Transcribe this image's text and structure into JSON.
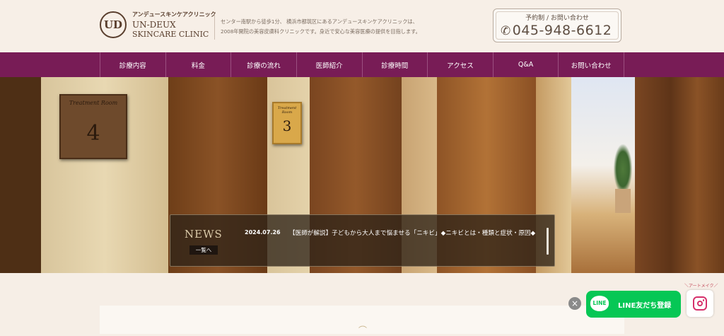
{
  "header": {
    "logo_mark": "UD",
    "logo_jp": "アンデュースキンケアクリニック",
    "logo_en_line1": "UN-DEUX",
    "logo_en_line2": "SKINCARE CLINIC",
    "description_line1": "センター南駅から徒歩1分、 横浜市都筑区にあるアンデュースキンケアクリニックは、",
    "description_line2": "2008年開院の美容皮膚科クリニックです。身近で安心な美容医療の提供を目指します。",
    "contact_label": "予約制 / お問い合わせ",
    "phone": "045-948-6612",
    "phone_icon": "phone-icon"
  },
  "nav": {
    "items": [
      {
        "label": "診療内容"
      },
      {
        "label": "料金"
      },
      {
        "label": "診療の流れ"
      },
      {
        "label": "医師紹介"
      },
      {
        "label": "診療時間"
      },
      {
        "label": "アクセス"
      },
      {
        "label": "Q&A"
      },
      {
        "label": "お問い合わせ"
      }
    ]
  },
  "hero": {
    "sign_left_title": "Treatment Room",
    "sign_left_number": "4",
    "sign_right_title": "Treatment Room",
    "sign_right_number": "3"
  },
  "news": {
    "title": "NEWS",
    "more_label": "一覧へ",
    "items": [
      {
        "date": "2024.07.26",
        "text": "【医師が解説】子どもから大人まで悩ませる「ニキビ」◆ニキビとは・種類と症状・原因◆"
      }
    ]
  },
  "floating": {
    "line_logo": "LINE",
    "line_label": "LINE友だち登録",
    "art_make_label": "＼アートメイク／",
    "close_label": "×"
  },
  "colors": {
    "nav_bg": "#781c56",
    "page_bg": "#f6eee6",
    "line_green": "#06c755",
    "instagram": "#d6306b"
  }
}
